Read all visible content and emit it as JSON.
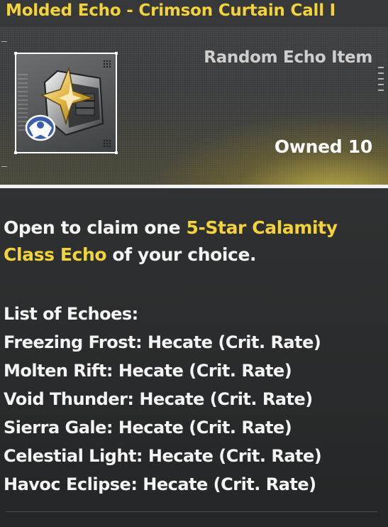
{
  "item": {
    "title": "Molded Echo - Crimson Curtain Call I",
    "type": "Random Echo Item",
    "owned": "Owned 10",
    "icon": "echo-box-icon"
  },
  "description": {
    "part1": "Open to claim one ",
    "highlight": "5-Star Calamity Class Echo",
    "part2": " of your choice."
  },
  "echo_list": {
    "heading": "List of Echoes:",
    "items": [
      "Freezing Frost: Hecate (Crit. Rate)",
      "Molten Rift: Hecate (Crit. Rate)",
      "Void Thunder: Hecate (Crit. Rate)",
      "Sierra Gale: Hecate (Crit. Rate)",
      "Celestial Light: Hecate (Crit. Rate)",
      "Havoc Eclipse: Hecate (Crit. Rate)"
    ]
  },
  "colors": {
    "accent": "#f4d23a",
    "panel": "#2a2c2d"
  }
}
